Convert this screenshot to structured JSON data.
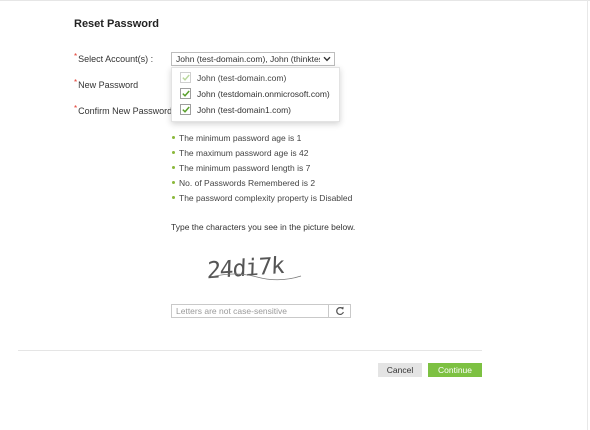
{
  "page": {
    "title": "Reset Password"
  },
  "form": {
    "required_mark": "*",
    "select_account_label": "Select Account(s) :",
    "new_password_label": "New Password",
    "confirm_password_label": "Confirm New Password",
    "account_select_value": "John (test-domain.com), John (thinktest"
  },
  "accounts": [
    {
      "label": "John (test-domain.com)",
      "checked": true,
      "disabled": true
    },
    {
      "label": "John (testdomain.onmicrosoft.com)",
      "checked": true,
      "disabled": false
    },
    {
      "label": "John (test-domain1.com)",
      "checked": true,
      "disabled": false
    }
  ],
  "policy_rules": [
    "The minimum password age is 1",
    "The maximum password age is 42",
    "The minimum password length is 7",
    "No. of Passwords Remembered is 2",
    "The password complexity property is Disabled"
  ],
  "captcha": {
    "instruction": "Type the characters you see in the picture below.",
    "image_text": "24di7k",
    "input_value": "",
    "input_placeholder": "Letters are not case-sensitive",
    "refresh_icon": "refresh-icon"
  },
  "actions": {
    "cancel_label": "Cancel",
    "continue_label": "Continue"
  },
  "colors": {
    "accent_green": "#7dc142",
    "required_red": "#e23b2e",
    "bullet_green": "#8ab83a",
    "checkbox_green": "#5aa02c",
    "checkbox_disabled": "#b9d89c"
  }
}
